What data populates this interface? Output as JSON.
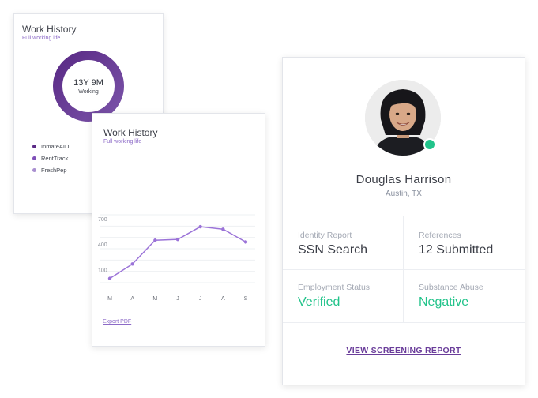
{
  "work_history_summary": {
    "title": "Work History",
    "subtitle": "Full working life",
    "total_duration": "13Y 9M",
    "status": "Working",
    "legend": [
      {
        "name": "InmateAID",
        "color": "#5b2a86"
      },
      {
        "name": "RentTrack",
        "color": "#7f4fb8"
      },
      {
        "name": "FreshPep",
        "color": "#a98fd0"
      }
    ]
  },
  "work_history_chart": {
    "title": "Work History",
    "subtitle": "Full working life",
    "export_label": "Export PDF"
  },
  "chart_data": {
    "type": "line",
    "categories": [
      "M",
      "A",
      "M",
      "J",
      "J",
      "A",
      "S"
    ],
    "yticks": [
      100,
      400,
      700
    ],
    "ylim": [
      0,
      800
    ],
    "series": [
      {
        "values": [
          50,
          220,
          500,
          510,
          660,
          630,
          480
        ]
      }
    ],
    "line_color": "#9b73d8",
    "grid": true
  },
  "profile": {
    "name": "Douglas  Harrison",
    "location": "Austin, TX",
    "online_color": "#21c38a",
    "details": [
      {
        "label": "Identity Report",
        "value": "SSN Search",
        "highlight": false
      },
      {
        "label": "References",
        "value": "12 Submitted",
        "highlight": false
      },
      {
        "label": "Employment Status",
        "value": "Verified",
        "highlight": true
      },
      {
        "label": "Substance Abuse",
        "value": "Negative",
        "highlight": true
      }
    ],
    "report_link": "VIEW SCREENING REPORT"
  }
}
